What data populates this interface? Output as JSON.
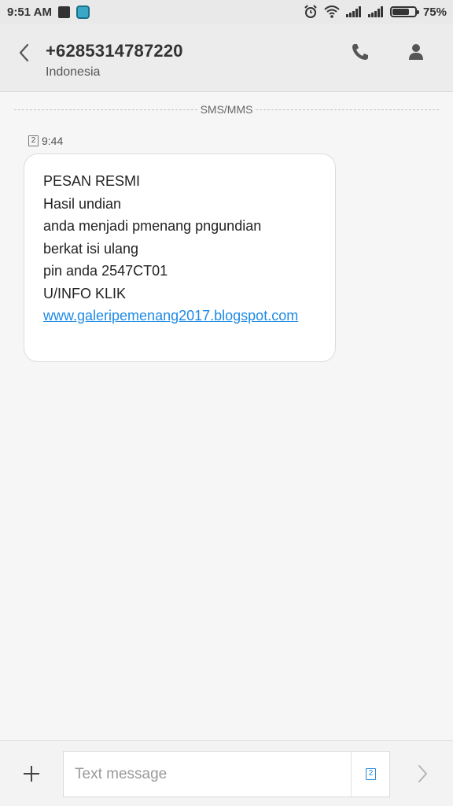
{
  "status_bar": {
    "time": "9:51 AM",
    "notification_icons": [
      "bbm-icon",
      "game-icon"
    ],
    "system_icons": [
      "alarm-icon",
      "wifi-icon",
      "signal-icon",
      "signal-icon"
    ],
    "battery_percent": "75%",
    "battery_level": 0.75
  },
  "header": {
    "contact_number": "+6285314787220",
    "contact_country": "Indonesia"
  },
  "thread": {
    "divider_label": "SMS/MMS",
    "message": {
      "sim": "2",
      "time": "9:44",
      "lines": [
        "PESAN RESMI",
        "Hasil undian",
        "anda menjadi pmenang pngundian",
        "berkat isi ulang",
        "pin anda 2547CT01",
        "U/INFO KLIK"
      ],
      "link": "www.galeripemenang2017.blogspot.com"
    }
  },
  "composer": {
    "placeholder": "Text message",
    "sim": "2"
  },
  "colors": {
    "link": "#1e8ae6",
    "header_bg": "#ececec",
    "page_bg": "#f6f6f6"
  }
}
